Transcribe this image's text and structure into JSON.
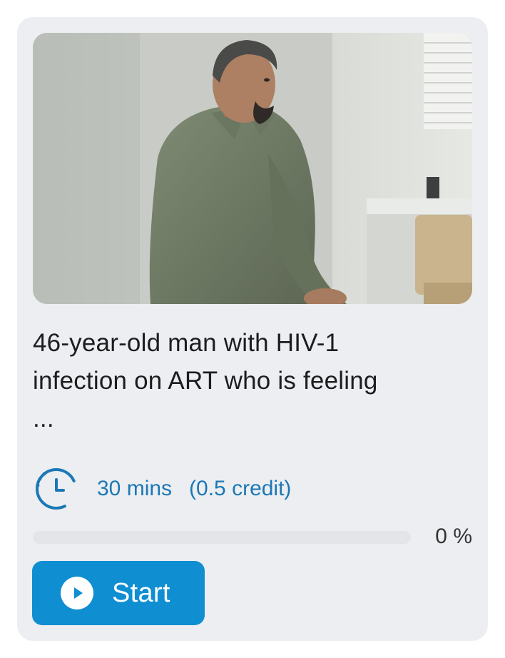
{
  "course": {
    "title_line1": "46-year-old man with HIV-1",
    "title_line2": "infection on ART who is feeling",
    "title_line3": "...",
    "thumbnail_icon": "patient-photo",
    "duration": "30 mins",
    "credit": "(0.5 credit)",
    "clock_icon": "clock-icon",
    "progress_percent": 0,
    "progress_label": "0 %",
    "start_label": "Start",
    "play_icon": "play-icon",
    "colors": {
      "card_bg": "#eceef1",
      "accent": "#0f8ed2",
      "meta_text": "#1c78b5"
    }
  }
}
